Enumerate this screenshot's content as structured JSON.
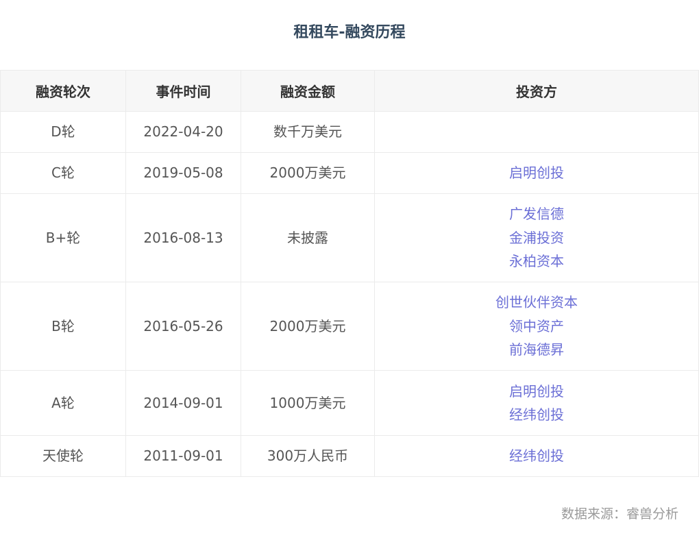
{
  "title": "租租车-融资历程",
  "table": {
    "headers": [
      "融资轮次",
      "事件时间",
      "融资金额",
      "投资方"
    ],
    "rows": [
      {
        "round": "D轮",
        "date": "2022-04-20",
        "amount": "数千万美元",
        "investors": []
      },
      {
        "round": "C轮",
        "date": "2019-05-08",
        "amount": "2000万美元",
        "investors": [
          "启明创投"
        ]
      },
      {
        "round": "B+轮",
        "date": "2016-08-13",
        "amount": "未披露",
        "investors": [
          "广发信德",
          "金浦投资",
          "永柏资本"
        ]
      },
      {
        "round": "B轮",
        "date": "2016-05-26",
        "amount": "2000万美元",
        "investors": [
          "创世伙伴资本",
          "领中资产",
          "前海德昇"
        ]
      },
      {
        "round": "A轮",
        "date": "2014-09-01",
        "amount": "1000万美元",
        "investors": [
          "启明创投",
          "经纬创投"
        ]
      },
      {
        "round": "天使轮",
        "date": "2011-09-01",
        "amount": "300万人民币",
        "investors": [
          "经纬创投"
        ]
      }
    ]
  },
  "source": "数据来源：睿兽分析",
  "colors": {
    "title": "#34495e",
    "header_bg": "#f7f7f7",
    "investor_link": "#6b6fd6",
    "border": "#ebebeb"
  }
}
